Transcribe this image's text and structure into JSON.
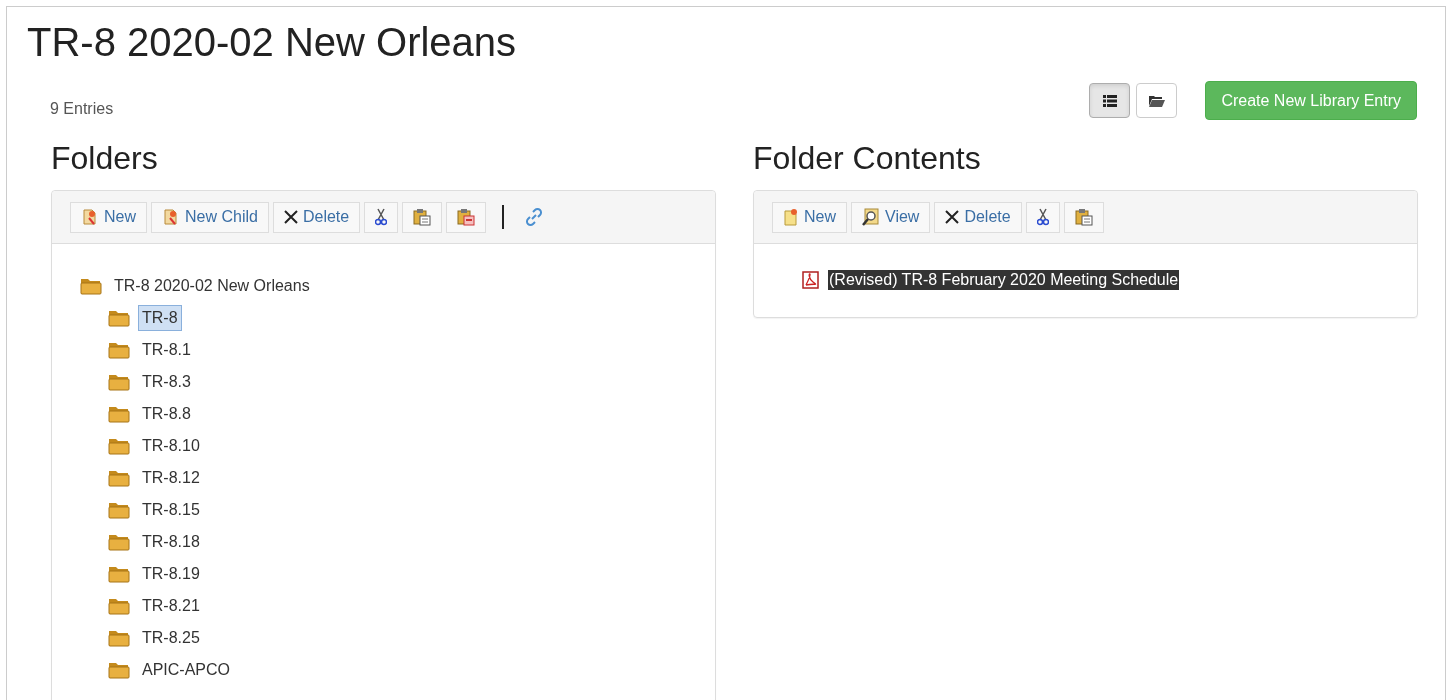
{
  "title": "TR-8 2020-02 New Orleans",
  "entry_count": "9 Entries",
  "view_toggle": [
    {
      "kind": "list",
      "selected": true
    },
    {
      "kind": "folder",
      "selected": false
    }
  ],
  "create_button": "Create New Library Entry",
  "folders": {
    "heading": "Folders",
    "toolbar": [
      {
        "kind": "new",
        "label": "New"
      },
      {
        "kind": "new-child",
        "label": "New Child"
      },
      {
        "kind": "delete",
        "label": "Delete"
      },
      {
        "kind": "cut"
      },
      {
        "kind": "paste"
      },
      {
        "kind": "paste-into"
      },
      {
        "kind": "separator"
      },
      {
        "kind": "link"
      }
    ],
    "tree": [
      {
        "label": "TR-8 2020-02 New Orleans",
        "selected": false,
        "children": [
          {
            "label": "TR-8",
            "selected": true
          },
          {
            "label": "TR-8.1",
            "selected": false
          },
          {
            "label": "TR-8.3",
            "selected": false
          },
          {
            "label": "TR-8.8",
            "selected": false
          },
          {
            "label": "TR-8.10",
            "selected": false
          },
          {
            "label": "TR-8.12",
            "selected": false
          },
          {
            "label": "TR-8.15",
            "selected": false
          },
          {
            "label": "TR-8.18",
            "selected": false
          },
          {
            "label": "TR-8.19",
            "selected": false
          },
          {
            "label": "TR-8.21",
            "selected": false
          },
          {
            "label": "TR-8.25",
            "selected": false
          },
          {
            "label": "APIC-APCO",
            "selected": false
          }
        ]
      }
    ]
  },
  "contents": {
    "heading": "Folder Contents",
    "toolbar": [
      {
        "kind": "new-file",
        "label": "New"
      },
      {
        "kind": "view",
        "label": "View"
      },
      {
        "kind": "delete",
        "label": "Delete"
      },
      {
        "kind": "cut"
      },
      {
        "kind": "paste"
      }
    ],
    "items": [
      {
        "label": "(Revised) TR-8 February 2020 Meeting Schedule",
        "selected": true
      }
    ]
  }
}
